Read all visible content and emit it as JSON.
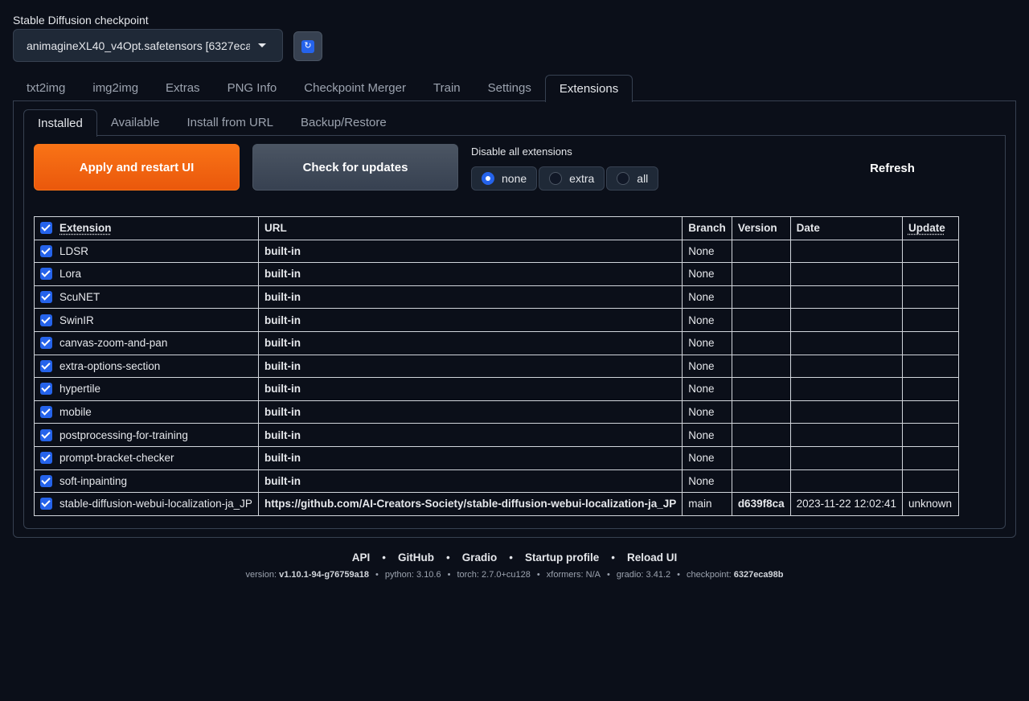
{
  "checkpoint": {
    "label": "Stable Diffusion checkpoint",
    "value": "animagineXL40_v4Opt.safetensors [6327eca98b",
    "refresh_icon": "refresh-icon"
  },
  "tabs": [
    {
      "label": "txt2img"
    },
    {
      "label": "img2img"
    },
    {
      "label": "Extras"
    },
    {
      "label": "PNG Info"
    },
    {
      "label": "Checkpoint Merger"
    },
    {
      "label": "Train"
    },
    {
      "label": "Settings"
    },
    {
      "label": "Extensions"
    }
  ],
  "subtabs": [
    {
      "label": "Installed"
    },
    {
      "label": "Available"
    },
    {
      "label": "Install from URL"
    },
    {
      "label": "Backup/Restore"
    }
  ],
  "actions": {
    "apply_label": "Apply and restart UI",
    "check_label": "Check for updates",
    "disable_label": "Disable all extensions",
    "radio_options": [
      "none",
      "extra",
      "all"
    ],
    "radio_selected": "none",
    "refresh_label": "Refresh"
  },
  "table": {
    "headers": [
      "Extension",
      "URL",
      "Branch",
      "Version",
      "Date",
      "Update"
    ],
    "rows": [
      {
        "name": "LDSR",
        "url": "built-in",
        "branch": "None",
        "version": "",
        "date": "",
        "update": ""
      },
      {
        "name": "Lora",
        "url": "built-in",
        "branch": "None",
        "version": "",
        "date": "",
        "update": ""
      },
      {
        "name": "ScuNET",
        "url": "built-in",
        "branch": "None",
        "version": "",
        "date": "",
        "update": ""
      },
      {
        "name": "SwinIR",
        "url": "built-in",
        "branch": "None",
        "version": "",
        "date": "",
        "update": ""
      },
      {
        "name": "canvas-zoom-and-pan",
        "url": "built-in",
        "branch": "None",
        "version": "",
        "date": "",
        "update": ""
      },
      {
        "name": "extra-options-section",
        "url": "built-in",
        "branch": "None",
        "version": "",
        "date": "",
        "update": ""
      },
      {
        "name": "hypertile",
        "url": "built-in",
        "branch": "None",
        "version": "",
        "date": "",
        "update": ""
      },
      {
        "name": "mobile",
        "url": "built-in",
        "branch": "None",
        "version": "",
        "date": "",
        "update": ""
      },
      {
        "name": "postprocessing-for-training",
        "url": "built-in",
        "branch": "None",
        "version": "",
        "date": "",
        "update": ""
      },
      {
        "name": "prompt-bracket-checker",
        "url": "built-in",
        "branch": "None",
        "version": "",
        "date": "",
        "update": ""
      },
      {
        "name": "soft-inpainting",
        "url": "built-in",
        "branch": "None",
        "version": "",
        "date": "",
        "update": ""
      },
      {
        "name": "stable-diffusion-webui-localization-ja_JP",
        "url": "https://github.com/AI-Creators-Society/stable-diffusion-webui-localization-ja_JP",
        "branch": "main",
        "version": "d639f8ca",
        "date": "2023-11-22 12:02:41",
        "update": "unknown"
      }
    ]
  },
  "footer": {
    "links": [
      "API",
      "GitHub",
      "Gradio",
      "Startup profile",
      "Reload UI"
    ],
    "separator": "•",
    "version_label": "version:",
    "version_value": "v1.10.1-94-g76759a18",
    "python": "python: 3.10.6",
    "torch": "torch: 2.7.0+cu128",
    "xformers": "xformers: N/A",
    "gradio": "gradio: 3.41.2",
    "checkpoint_label": "checkpoint:",
    "checkpoint_value": "6327eca98b"
  },
  "colors": {
    "background": "#0b0f19",
    "primary": "#f97316",
    "secondary": "#374151",
    "accent": "#2563eb"
  }
}
